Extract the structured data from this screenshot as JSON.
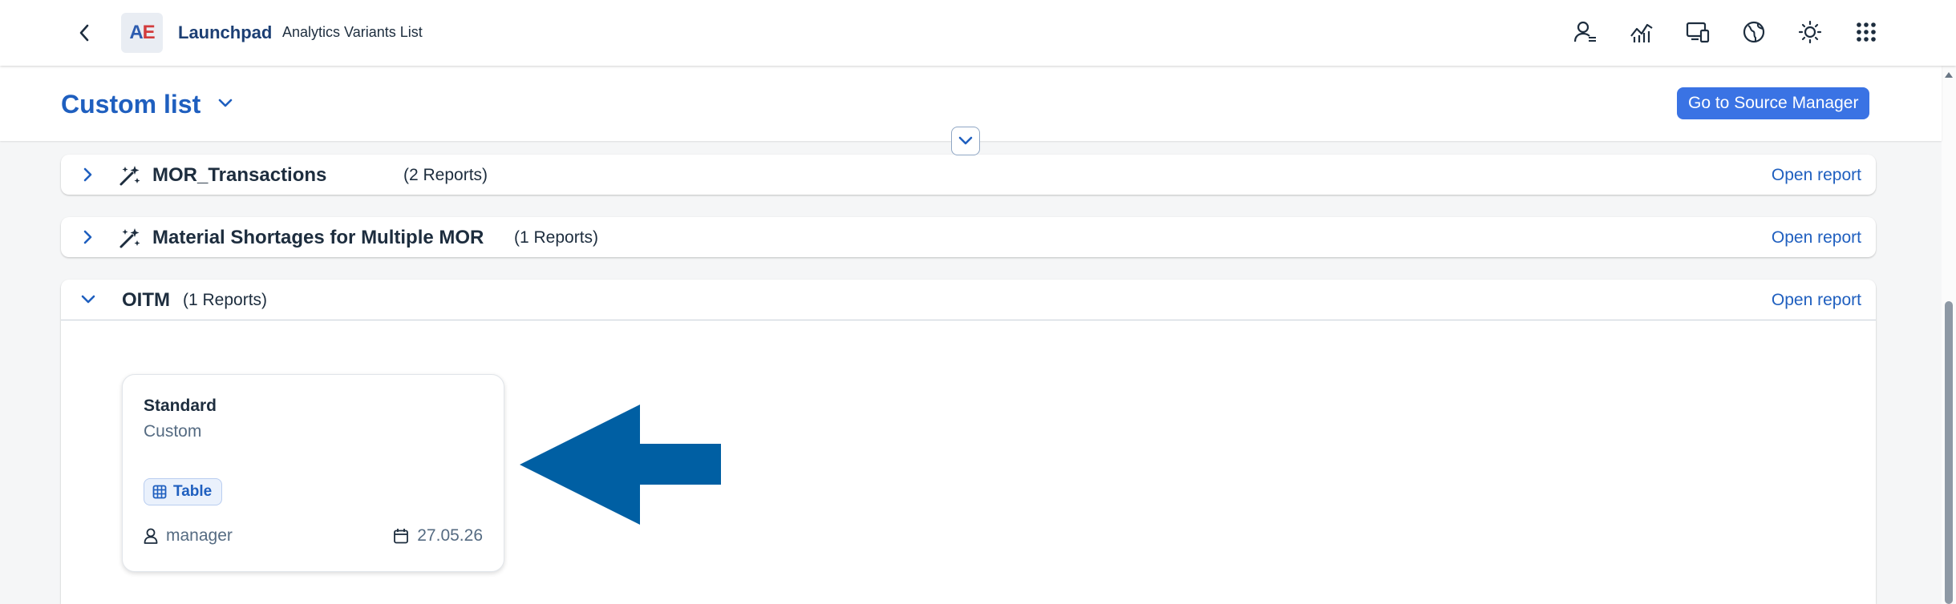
{
  "shell": {
    "app_logo_a": "A",
    "app_logo_e": "E",
    "title": "Launchpad",
    "subtitle": "Analytics Variants List",
    "icons": [
      "user-settings-icon",
      "analytics-icon",
      "device-icon",
      "globe-icon",
      "theme-icon",
      "apps-grid-icon"
    ]
  },
  "page": {
    "title": "Custom list",
    "go_to_source_label": "Go to Source Manager"
  },
  "panels": [
    {
      "name": "MOR_Transactions",
      "count": "(2 Reports)",
      "open_label": "Open report",
      "expanded": false,
      "icon": "wand-icon"
    },
    {
      "name": "Material Shortages for Multiple MOR",
      "count": "(1 Reports)",
      "open_label": "Open report",
      "expanded": false,
      "icon": "wand-icon"
    },
    {
      "name": "OITM",
      "count": "(1 Reports)",
      "open_label": "Open report",
      "expanded": true
    }
  ],
  "variant_card": {
    "title": "Standard",
    "subtitle": "Custom",
    "type_tag": "Table",
    "owner": "manager",
    "date": "27.05.26"
  },
  "colors": {
    "brand_blue": "#1f5fbf",
    "button_blue": "#3a73e4",
    "annotation_arrow": "#005fa3"
  }
}
